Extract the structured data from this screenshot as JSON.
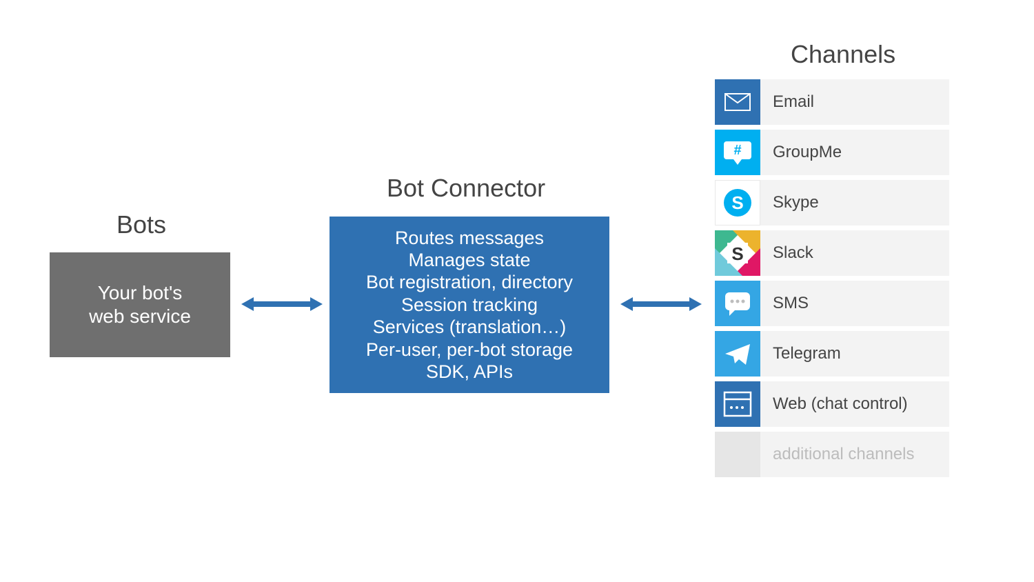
{
  "bots": {
    "title": "Bots",
    "box_line1": "Your bot's",
    "box_line2": "web service"
  },
  "connector": {
    "title": "Bot Connector",
    "lines": [
      "Routes messages",
      "Manages state",
      "Bot registration, directory",
      "Session tracking",
      "Services (translation…)",
      "Per-user, per-bot storage",
      "SDK, APIs"
    ]
  },
  "channels": {
    "title": "Channels",
    "items": [
      {
        "label": "Email",
        "icon": "email"
      },
      {
        "label": "GroupMe",
        "icon": "groupme"
      },
      {
        "label": "Skype",
        "icon": "skype"
      },
      {
        "label": "Slack",
        "icon": "slack"
      },
      {
        "label": "SMS",
        "icon": "sms"
      },
      {
        "label": "Telegram",
        "icon": "telegram"
      },
      {
        "label": "Web (chat control)",
        "icon": "web"
      },
      {
        "label": "additional channels",
        "icon": "blank",
        "muted": true
      }
    ]
  }
}
